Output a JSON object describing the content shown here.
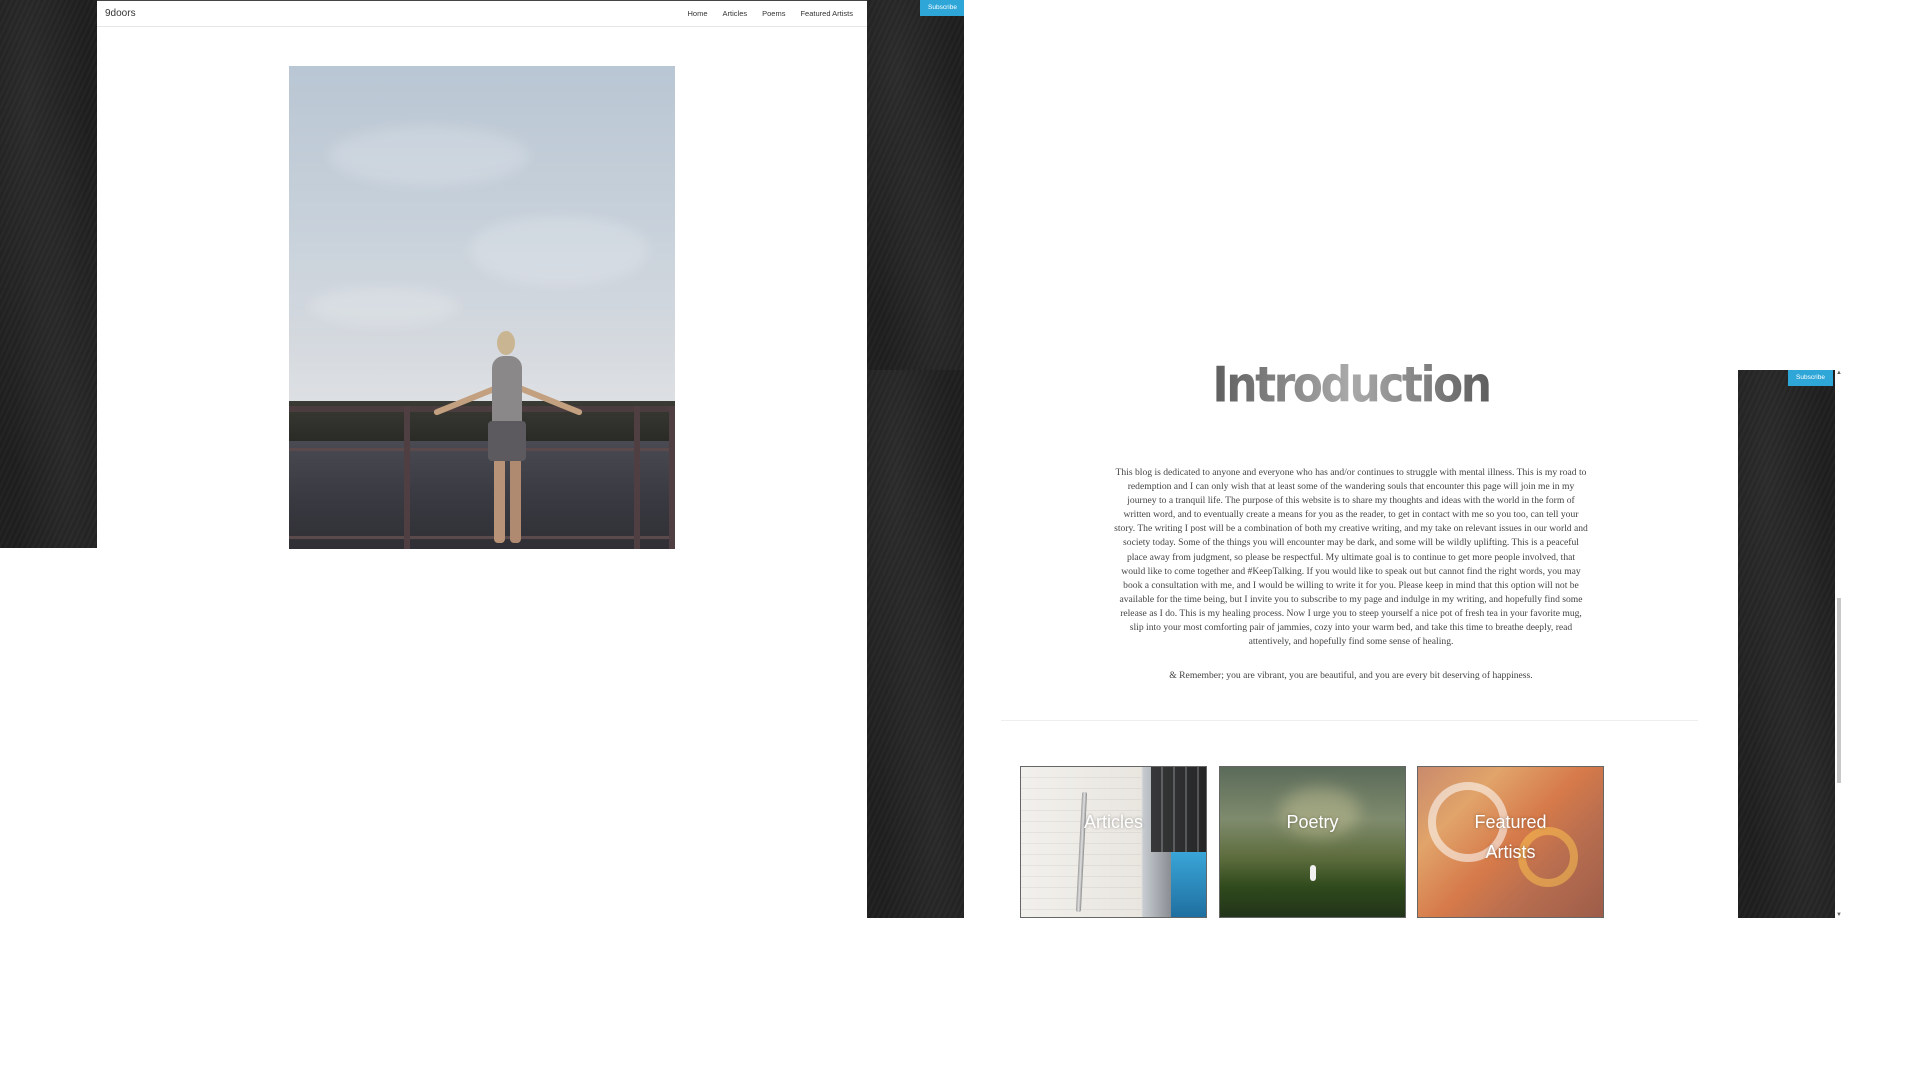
{
  "left_window": {
    "brand": "9doors",
    "nav": [
      "Home",
      "Articles",
      "Poems",
      "Featured Artists"
    ],
    "subscribe_label": "Subscribe"
  },
  "right_window": {
    "subscribe_label": "Subscribe",
    "intro": {
      "title": "Introduction",
      "body": "This blog is dedicated to anyone and everyone who has and/or continues to struggle with mental illness. This is my road to redemption and I can only wish that at least some of the wandering souls that encounter this page will join me in my journey to a tranquil life. The purpose of this website is to share my thoughts and ideas with the world in the form of written word, and to eventually create a means for you as the reader, to get in contact with me so you too, can tell your story. The writing I post will be a combination of both my creative writing, and my take on relevant issues in our world and society today. Some of the things you will encounter may be dark, and some will be wildly uplifting. This is a peaceful place away from judgment, so please be respectful. My ultimate goal is to continue to get more people involved, that would like to come together and #KeepTalking. If you would like to speak out but cannot find the right words, you may book a consultation with me, and I would be willing to write it for you. Please keep in mind that this option will not be available for the time being, but I invite you to subscribe to my page and indulge in my writing, and hopefully find some release as I do. This is my healing process. Now I urge you to steep yourself a nice pot of fresh tea in your favorite mug, slip into your most comforting pair of jammies, cozy into your warm bed, and take this time to breathe deeply, read attentively, and hopefully find some sense of healing.",
      "remember": "& Remember; you are vibrant, you are beautiful, and you are every bit deserving of happiness."
    },
    "cards": [
      {
        "label": "Articles"
      },
      {
        "label": "Poetry"
      },
      {
        "label": "Featured Artists"
      }
    ]
  },
  "colors": {
    "subscribe": "#2ea6d8",
    "background_dark": "#1f1f1f"
  }
}
